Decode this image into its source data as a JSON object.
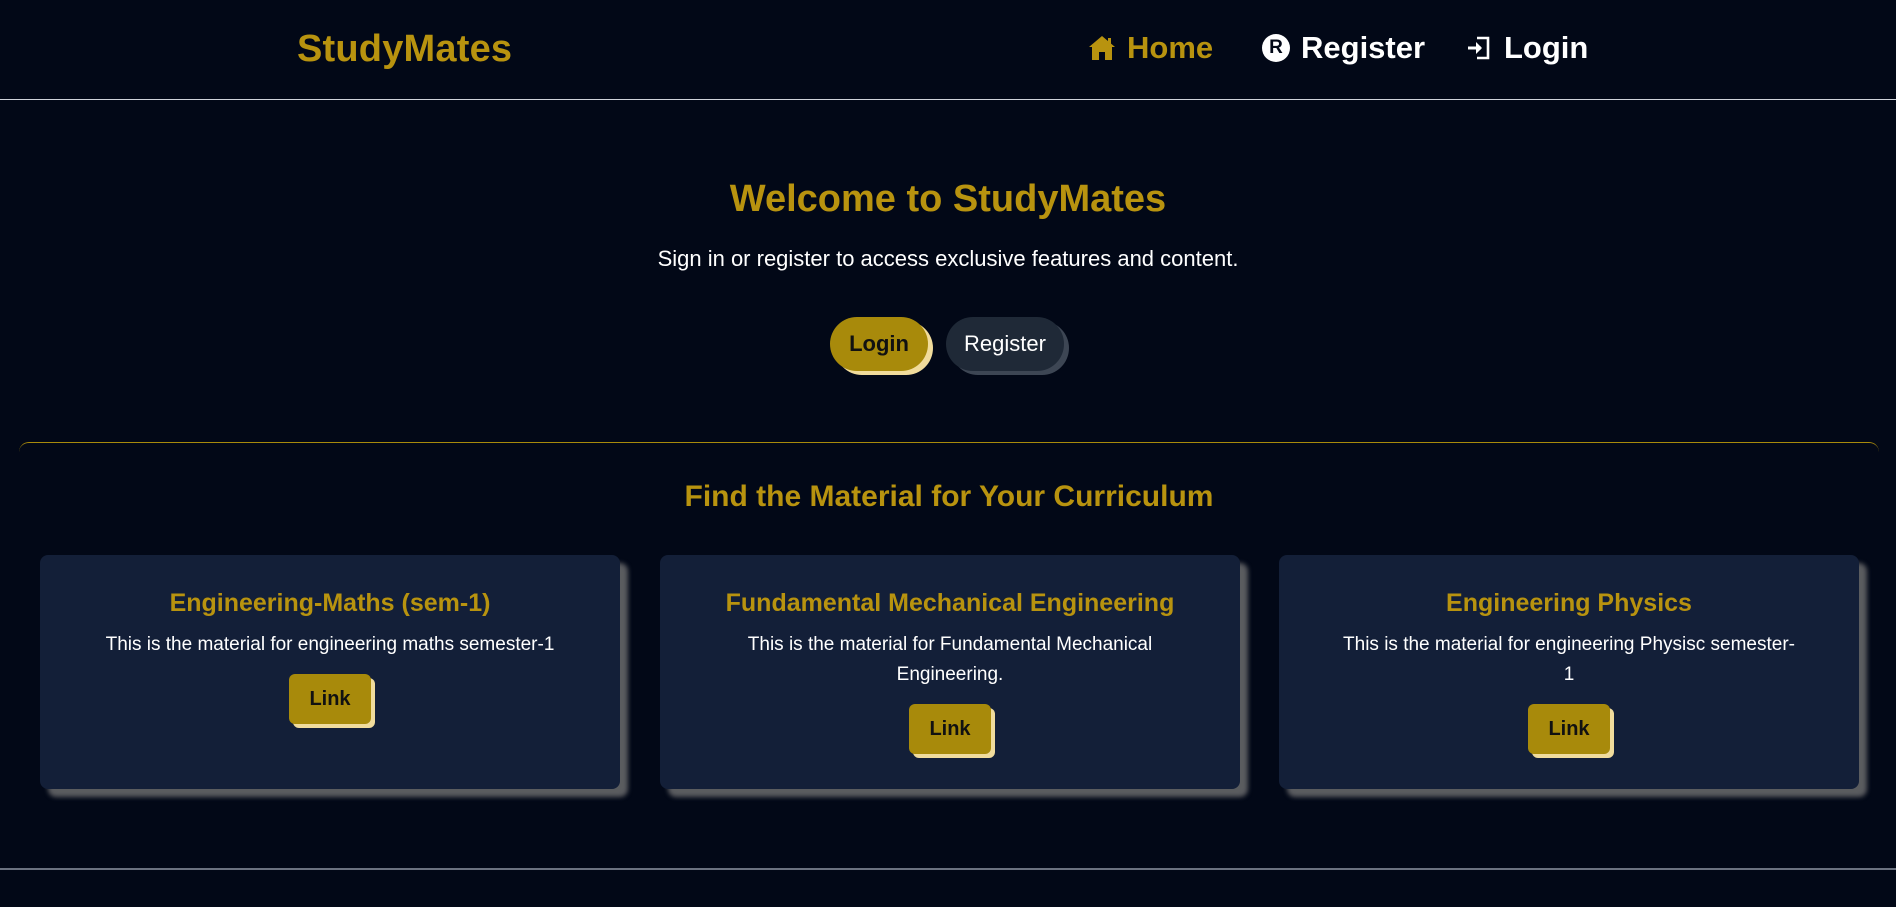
{
  "navbar": {
    "brand": "StudyMates",
    "links": [
      {
        "label": "Home",
        "icon": "home-icon",
        "active": true
      },
      {
        "label": "Register",
        "icon": "registered-icon",
        "icon_glyph": "R"
      },
      {
        "label": "Login",
        "icon": "sign-in-icon"
      }
    ]
  },
  "hero": {
    "title": "Welcome to StudyMates",
    "subtitle": "Sign in or register to access exclusive features and content.",
    "login_label": "Login",
    "register_label": "Register"
  },
  "materials": {
    "title": "Find the Material for Your Curriculum",
    "cards": [
      {
        "title": "Engineering-Maths (sem-1)",
        "description": "This is the material for engineering maths semester-1",
        "link_label": "Link"
      },
      {
        "title": "Fundamental Mechanical Engineering",
        "description": "This is the material for Fundamental Mechanical Engineering.",
        "link_label": "Link"
      },
      {
        "title": "Engineering Physics",
        "description": "This is the material for engineering Physisc semester-1",
        "link_label": "Link"
      }
    ]
  },
  "colors": {
    "background": "#020817",
    "accent": "#b8930f",
    "card": "#131f38"
  }
}
